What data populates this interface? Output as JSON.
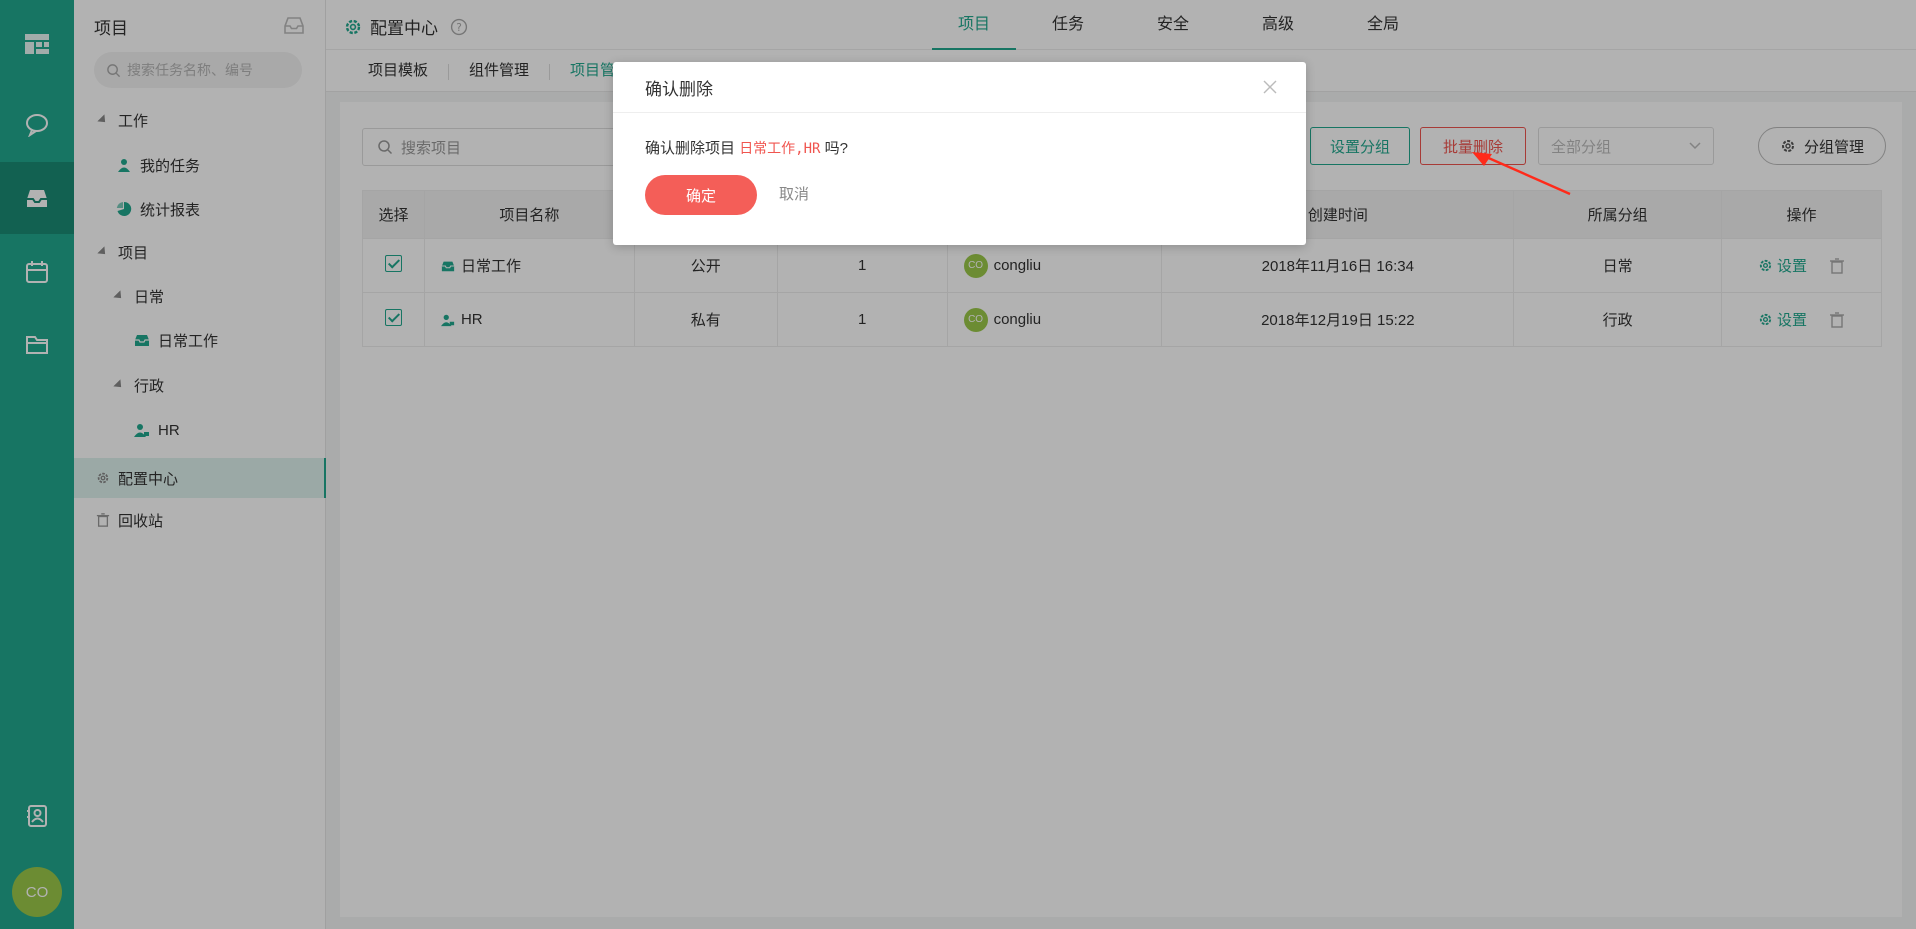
{
  "rail": {
    "avatar_text": "CO"
  },
  "sidebar": {
    "title": "项目",
    "search_placeholder": "搜索任务名称、编号",
    "items": [
      {
        "label": "工作"
      },
      {
        "label": "我的任务"
      },
      {
        "label": "统计报表"
      },
      {
        "label": "项目"
      },
      {
        "label": "日常"
      },
      {
        "label": "日常工作"
      },
      {
        "label": "行政"
      },
      {
        "label": "HR"
      },
      {
        "label": "配置中心"
      },
      {
        "label": "回收站"
      }
    ]
  },
  "topbar": {
    "title": "配置中心",
    "tabs": [
      {
        "label": "项目"
      },
      {
        "label": "任务"
      },
      {
        "label": "安全"
      },
      {
        "label": "高级"
      },
      {
        "label": "全局"
      }
    ]
  },
  "subtabs": [
    {
      "label": "项目模板"
    },
    {
      "label": "组件管理"
    },
    {
      "label": "项目管"
    }
  ],
  "toolbar": {
    "search_placeholder": "搜索项目",
    "set_group": "设置分组",
    "batch_delete": "批量删除",
    "group_select": "全部分组",
    "group_manage": "分组管理"
  },
  "table": {
    "headers": [
      "选择",
      "项目名称",
      "",
      "",
      "",
      "",
      "创建时间",
      "所属分组",
      "操作"
    ],
    "rows": [
      {
        "name": "日常工作",
        "visibility": "公开",
        "count": "1",
        "owner_avatar": "CO",
        "owner": "congliu",
        "created": "2018年11月16日 16:34",
        "group": "日常",
        "op": "设置"
      },
      {
        "name": "HR",
        "visibility": "私有",
        "count": "1",
        "owner_avatar": "CO",
        "owner": "congliu",
        "created": "2018年12月19日 15:22",
        "group": "行政",
        "op": "设置"
      }
    ]
  },
  "modal": {
    "title": "确认删除",
    "prefix": "确认删除项目",
    "names": "日常工作,HR",
    "suffix": "吗?",
    "ok": "确定",
    "cancel": "取消"
  },
  "colors": {
    "accent": "#22a88e",
    "danger": "#f0554f"
  }
}
